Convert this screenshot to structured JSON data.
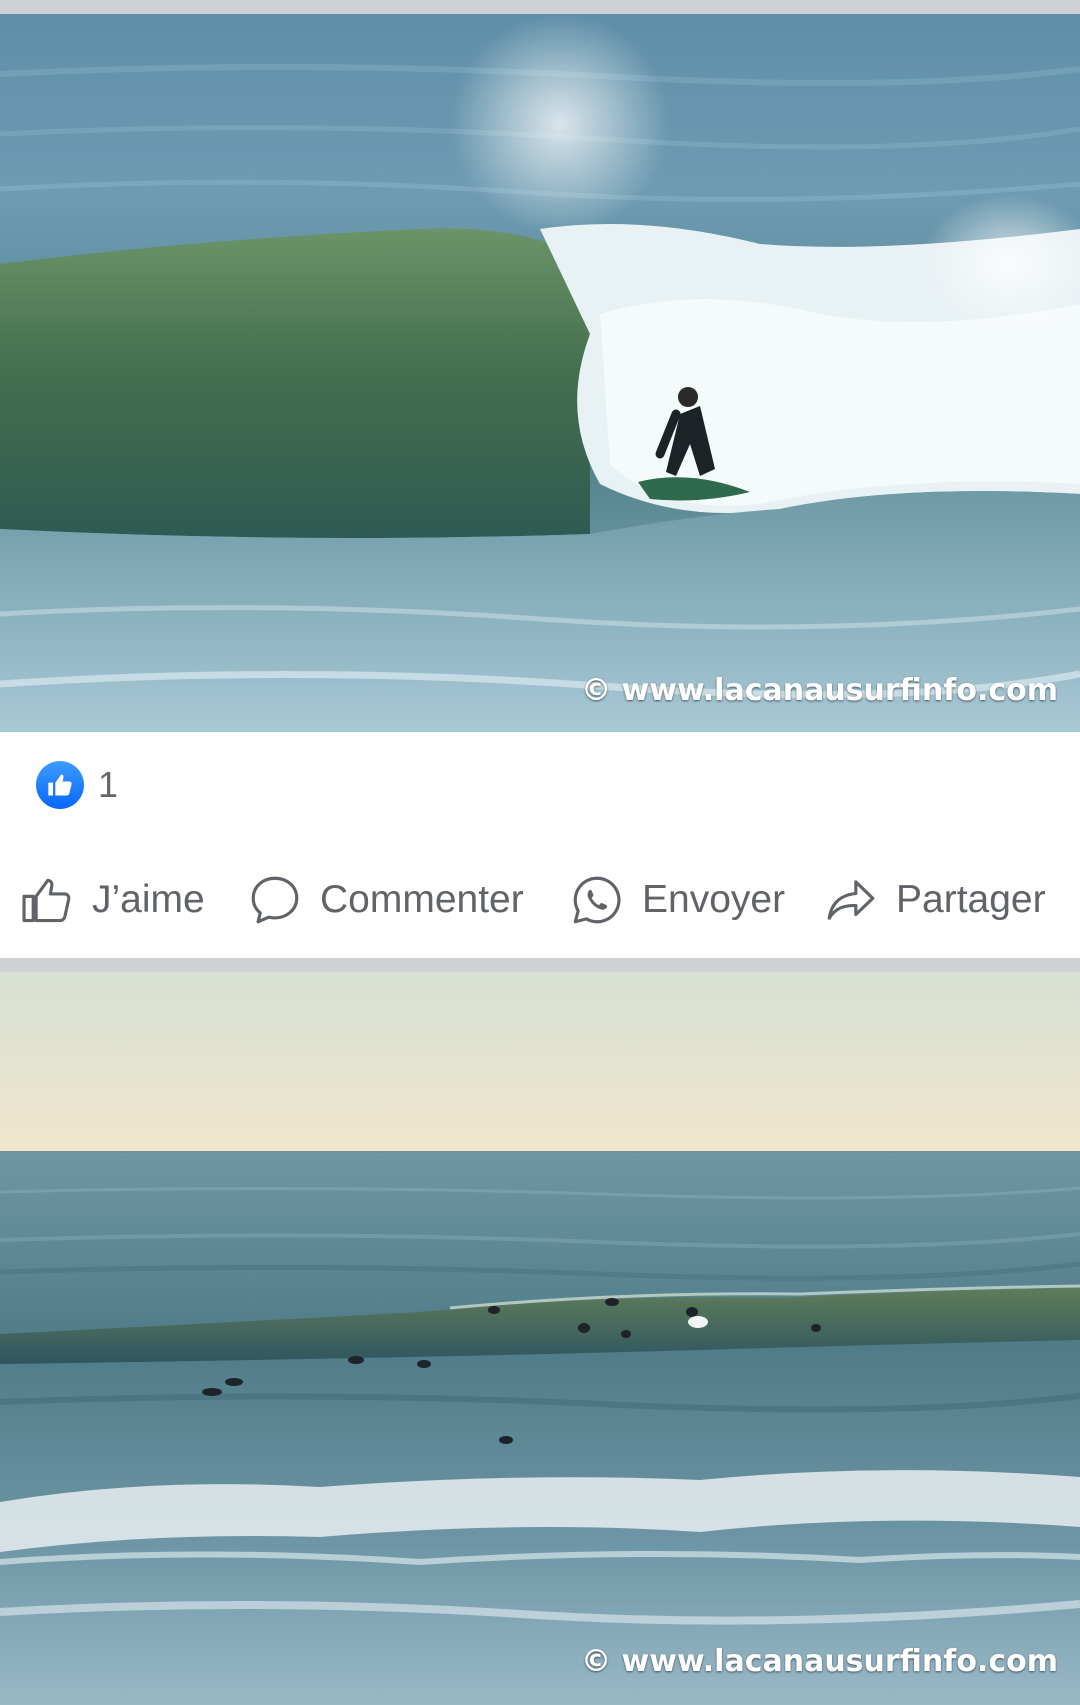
{
  "post": {
    "photos": [
      {
        "watermark": "© www.lacanausurfinfo.com",
        "alt_subject": "surfer in barrel"
      },
      {
        "watermark": "© www.lacanausurfinfo.com",
        "alt_subject": "surfers in lineup"
      }
    ],
    "reactions": {
      "icon": "thumbs-up-icon",
      "count": "1",
      "accent": "#0866ff"
    },
    "actions": [
      {
        "id": "like",
        "label": "J’aime",
        "icon": "thumbs-up-icon"
      },
      {
        "id": "comment",
        "label": "Commenter",
        "icon": "comment-bubble-icon"
      },
      {
        "id": "send",
        "label": "Envoyer",
        "icon": "whatsapp-icon"
      },
      {
        "id": "share",
        "label": "Partager",
        "icon": "share-arrow-icon"
      }
    ]
  },
  "colors": {
    "divider": "#cfd1d5",
    "action_text": "#606368",
    "count_text": "#65676b"
  }
}
